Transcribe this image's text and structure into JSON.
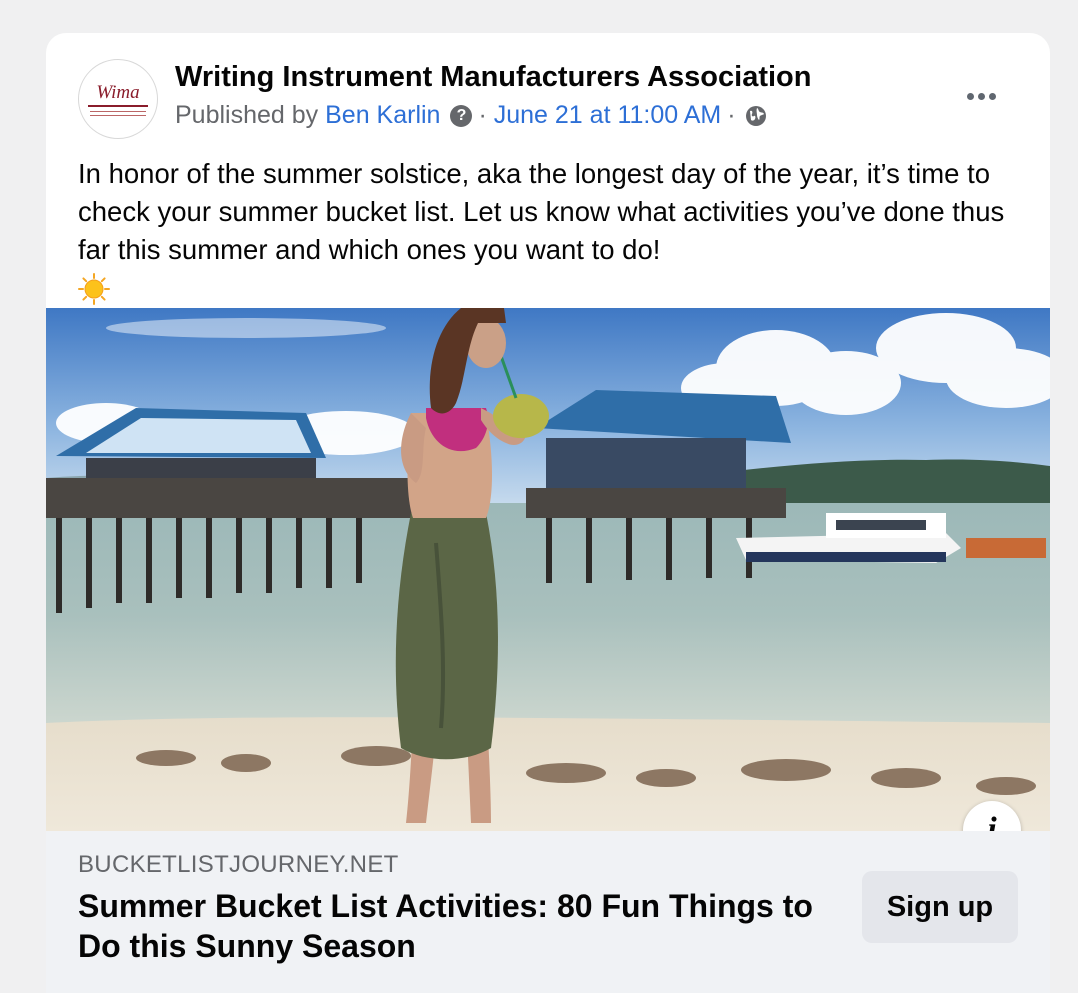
{
  "post": {
    "page_name": "Writing Instrument Manufacturers Association",
    "avatar_logo_text": "Wima",
    "published_by_prefix": "Published by",
    "author": "Ben Karlin",
    "help_icon": "?",
    "separator": "·",
    "timestamp": "June 21 at 11:00 AM",
    "audience_icon": "globe-icon",
    "more_icon": "more-options-icon",
    "text": "In honor of the summer solstice, aka the longest day of the year, it’s time to check your summer bucket list. Let us know what activities you’ve done thus far this summer and which ones you want to do!",
    "emoji": "sun-icon"
  },
  "link_preview": {
    "domain": "BUCKETLISTJOURNEY.NET",
    "title": "Summer Bucket List Activities: 80 Fun Things to Do this Sunny Season",
    "cta_label": "Sign up",
    "info_icon_glyph": "i"
  },
  "colors": {
    "link_blue": "#2d6fd6",
    "secondary_text": "#65676b",
    "preview_bg": "#f0f2f5",
    "button_bg": "#e4e6eb"
  }
}
